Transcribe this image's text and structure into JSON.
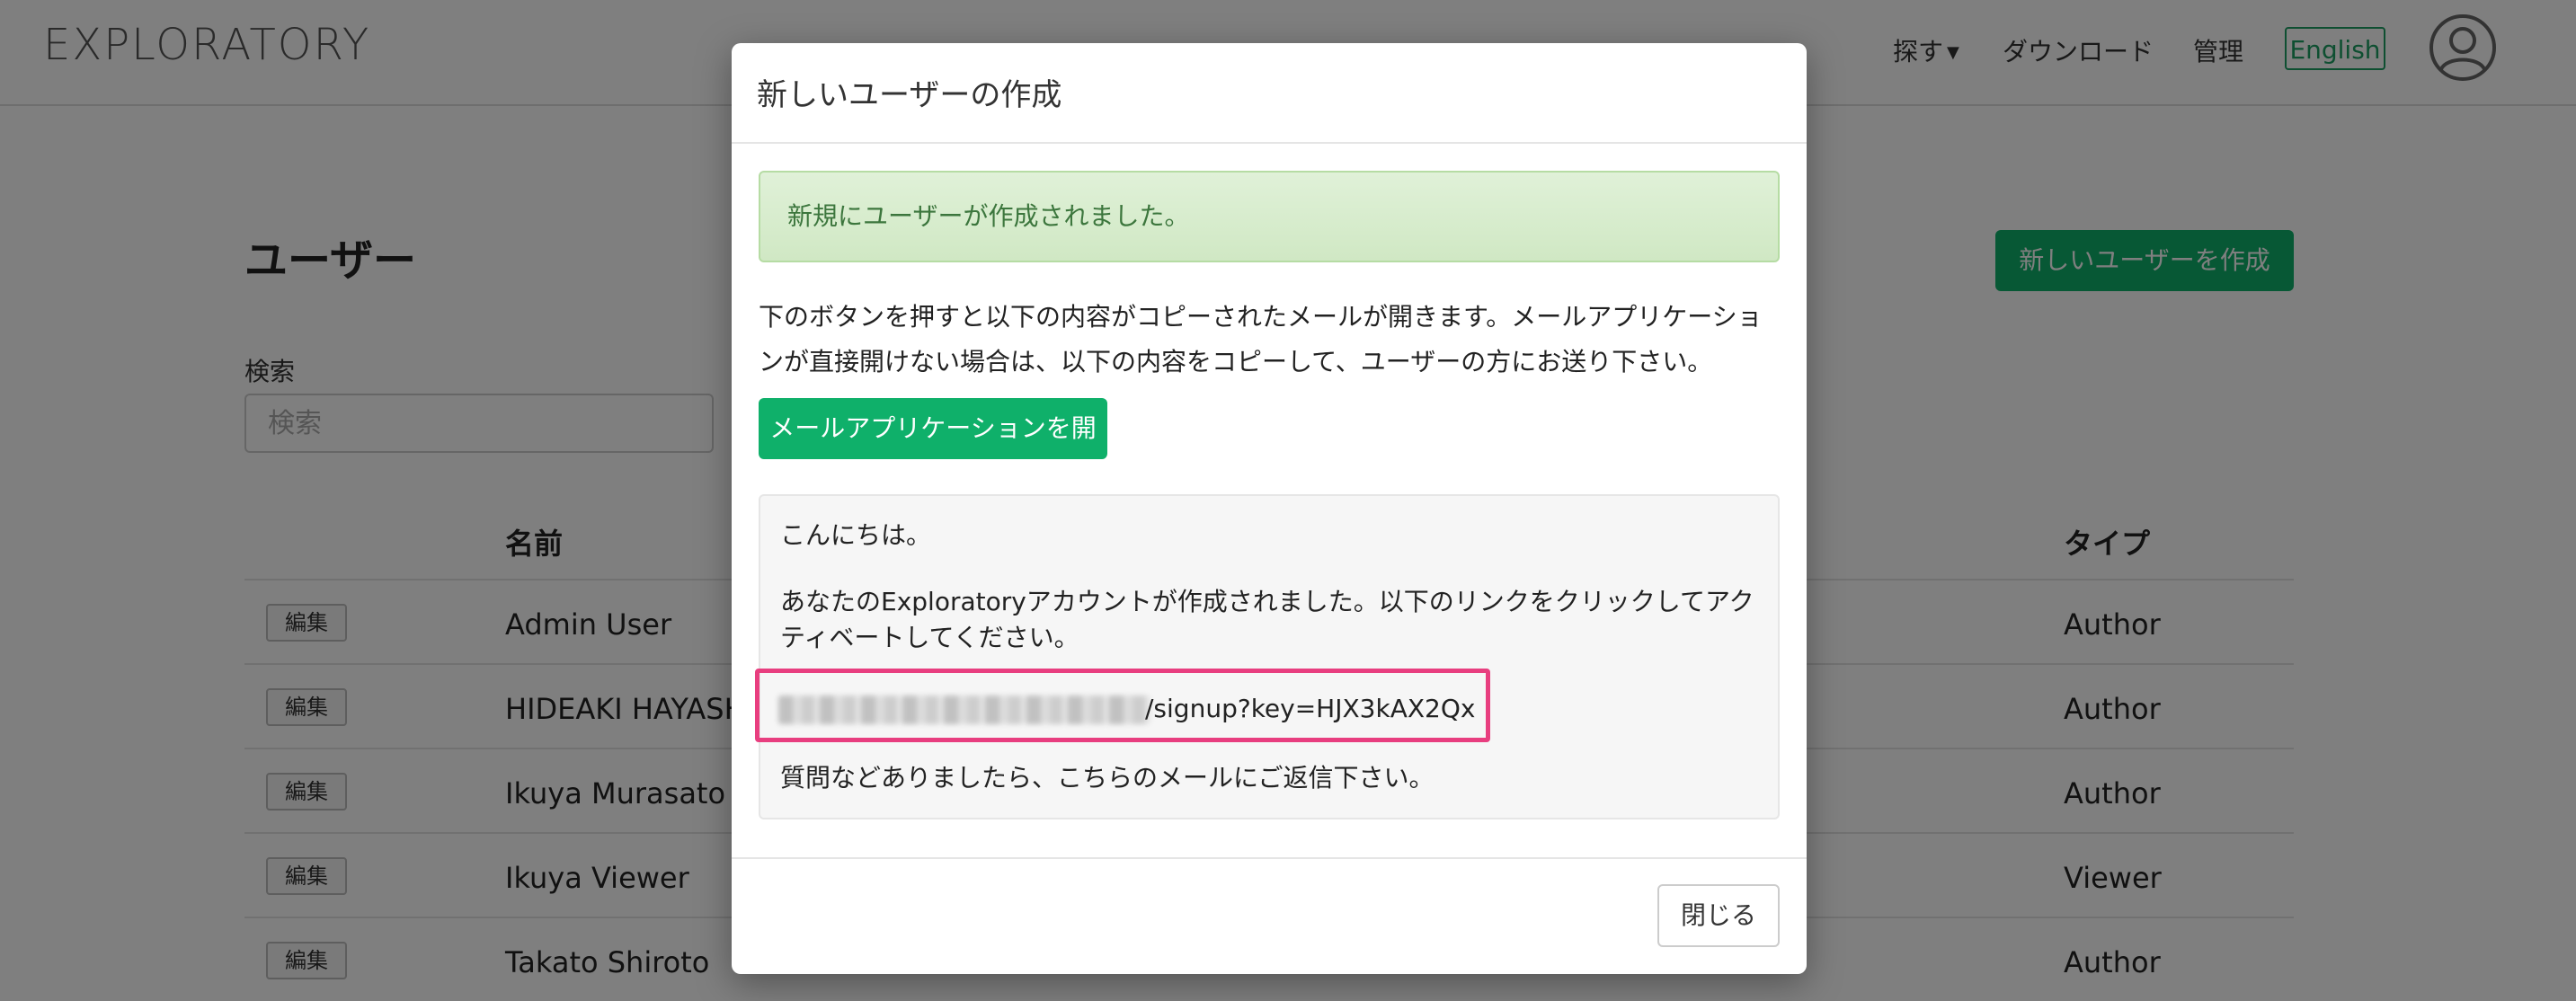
{
  "navbar": {
    "brand": "EXPLORATORY",
    "explore_label": "探す",
    "download_label": "ダウンロード",
    "admin_label": "管理",
    "language_label": "English",
    "avatar_icon": "user-circle-icon"
  },
  "page": {
    "title": "ユーザー",
    "new_user_button": "新しいユーザーを作成",
    "search_label": "検索",
    "search_placeholder": "検索"
  },
  "table": {
    "headers": {
      "name": "名前",
      "type": "タイプ"
    },
    "edit_label": "編集",
    "rows": [
      {
        "name": "Admin User",
        "type": "Author"
      },
      {
        "name": "HIDEAKI HAYASHI",
        "type": "Author"
      },
      {
        "name": "Ikuya Murasato",
        "type": "Author"
      },
      {
        "name": "Ikuya Viewer",
        "type": "Viewer"
      },
      {
        "name": "Takato Shiroto",
        "type": "Author"
      }
    ]
  },
  "modal": {
    "title": "新しいユーザーの作成",
    "success_message": "新規にユーザーが作成されました。",
    "instructions": "下のボタンを押すと以下の内容がコピーされたメールが開きます。メールアプリケーションが直接開けない場合は、以下の内容をコピーして、ユーザーの方にお送り下さい。",
    "open_mail_button": "メールアプリケーションを開く",
    "mail": {
      "greeting": "こんにちは。",
      "body": "あなたのExploratoryアカウントが作成されました。以下のリンクをクリックしてアクティベートしてください。",
      "link_suffix": "/signup?key=HJX3kAX2Qx",
      "closing": "質問などありましたら、こちらのメールにご返信下さい。"
    },
    "close_button": "閉じる"
  },
  "colors": {
    "brand_green": "#0fb06a",
    "success_text": "#3c763d",
    "highlight": "#e83e7f"
  }
}
